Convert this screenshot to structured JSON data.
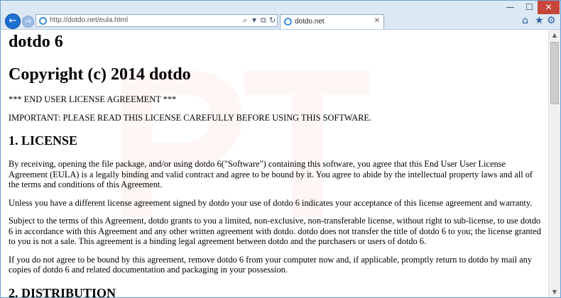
{
  "browser": {
    "url": "http://dotdo.net/eula.html",
    "tab_title": "dotdo.net",
    "window_buttons": {
      "minimize": "—",
      "maximize": "☐",
      "close": "✕"
    },
    "nav": {
      "back": "←",
      "forward": "→"
    },
    "address_icons": {
      "search": "⌕",
      "dropdown": "▼",
      "compat": "⧉",
      "refresh": "↻"
    },
    "tab_close": "✕",
    "toolbar_icons": {
      "home": "⌂",
      "favorites": "★",
      "settings": "⚙"
    },
    "scroll": {
      "up": "▲",
      "down": "▼"
    }
  },
  "watermark": "PT",
  "document": {
    "title": "dotdo 6",
    "copyright": "Copyright (c) 2014 dotdo",
    "eula_line": "*** END USER LICENSE AGREEMENT ***",
    "important": "IMPORTANT: PLEASE READ THIS LICENSE CAREFULLY BEFORE USING THIS SOFTWARE.",
    "section1_heading": "1. LICENSE",
    "paragraphs": [
      "By receiving, opening the file package, and/or using dotdo 6(\"Software\") containing this software, you agree that this End User User License Agreement (EULA) is a legally binding and valid contract and agree to be bound by it. You agree to abide by the intellectual property laws and all of the terms and conditions of this Agreement.",
      "Unless you have a different license agreement signed by dotdo your use of dotdo 6 indicates your acceptance of this license agreement and warranty.",
      "Subject to the terms of this Agreement, dotdo grants to you a limited, non-exclusive, non-transferable license, without right to sub-license, to use dotdo 6 in accordance with this Agreement and any other written agreement with dotdo. dotdo does not transfer the title of dotdo 6 to you; the license granted to you is not a sale. This agreement is a binding legal agreement between dotdo and the purchasers or users of dotdo 6.",
      "If you do not agree to be bound by this agreement, remove dotdo 6 from your computer now and, if applicable, promptly return to dotdo by mail any copies of dotdo 6 and related documentation and packaging in your possession."
    ],
    "section2_heading": "2. DISTRIBUTION"
  },
  "colors": {
    "chrome": "#dce9f5",
    "accent": "#1d6fd0",
    "close_button": "#c7463b"
  }
}
